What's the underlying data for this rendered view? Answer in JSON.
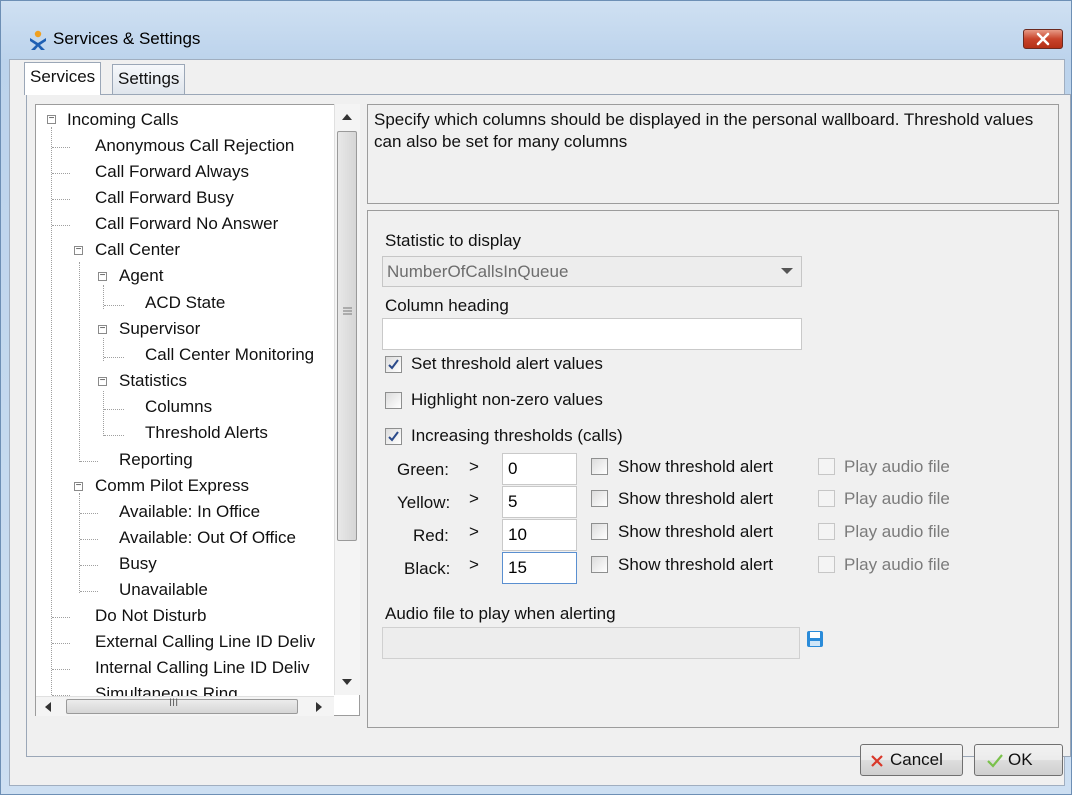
{
  "window": {
    "title": "Services & Settings"
  },
  "tabs": [
    {
      "label": "Services",
      "active": true
    },
    {
      "label": "Settings",
      "active": false
    }
  ],
  "tree": {
    "items": [
      {
        "label": "Incoming Calls"
      },
      {
        "label": "Anonymous Call Rejection"
      },
      {
        "label": "Call Forward Always"
      },
      {
        "label": "Call Forward Busy"
      },
      {
        "label": "Call Forward No Answer"
      },
      {
        "label": "Call Center"
      },
      {
        "label": "Agent"
      },
      {
        "label": "ACD State"
      },
      {
        "label": "Supervisor"
      },
      {
        "label": "Call Center Monitoring"
      },
      {
        "label": "Statistics"
      },
      {
        "label": "Columns",
        "selected": true
      },
      {
        "label": "Threshold Alerts"
      },
      {
        "label": "Reporting"
      },
      {
        "label": "Comm Pilot Express"
      },
      {
        "label": "Available: In Office"
      },
      {
        "label": "Available: Out Of Office"
      },
      {
        "label": "Busy"
      },
      {
        "label": "Unavailable"
      },
      {
        "label": "Do Not Disturb"
      },
      {
        "label": "External Calling Line ID Deliv"
      },
      {
        "label": "Internal Calling Line ID Deliv"
      },
      {
        "label": "Simultaneous Ring"
      }
    ]
  },
  "description": "Specify which columns should be displayed in the personal wallboard.  Threshold values can also be set for many columns",
  "form": {
    "statistic_label": "Statistic to display",
    "statistic_value": "NumberOfCallsInQueue",
    "heading_label": "Column heading",
    "heading_value": "",
    "set_threshold": {
      "label": "Set threshold alert values",
      "checked": true
    },
    "highlight_nonzero": {
      "label": "Highlight non-zero values",
      "checked": false
    },
    "increasing": {
      "label": "Increasing thresholds (calls)",
      "checked": true
    },
    "gt_symbol": ">",
    "thresholds": [
      {
        "name": "Green:",
        "value": "0",
        "show_label": "Show threshold alert",
        "audio_label": "Play audio file"
      },
      {
        "name": "Yellow:",
        "value": "5",
        "show_label": "Show threshold alert",
        "audio_label": "Play audio file"
      },
      {
        "name": "Red:",
        "value": "10",
        "show_label": "Show threshold alert",
        "audio_label": "Play audio file"
      },
      {
        "name": "Black:",
        "value": "15",
        "show_label": "Show threshold alert",
        "audio_label": "Play audio file"
      }
    ],
    "audio_label": "Audio file to play when alerting",
    "audio_value": ""
  },
  "buttons": {
    "cancel": "Cancel",
    "ok": "OK"
  },
  "scrollbar": {
    "h_thumb_glyph": "III"
  },
  "colors": {
    "accent": "#2a8bd9",
    "cancel_x": "#d9382a",
    "ok_check": "#7ac14b"
  }
}
